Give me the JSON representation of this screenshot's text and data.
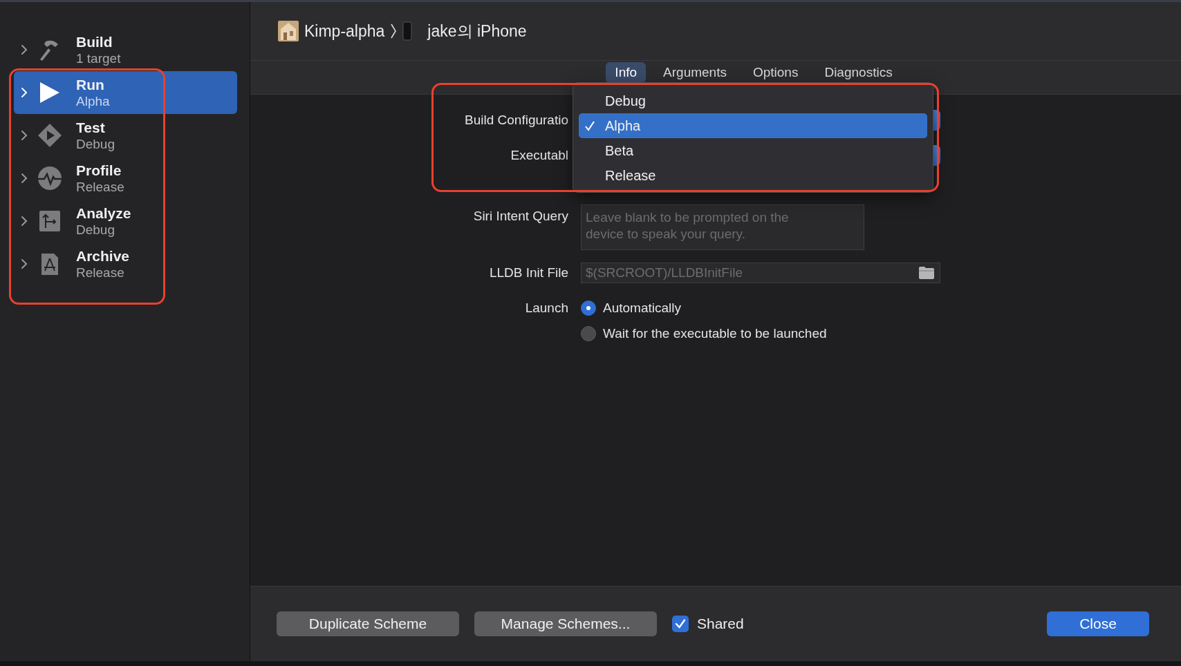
{
  "sidebar": {
    "actions": [
      {
        "kind": "build",
        "name": "Build",
        "detail": "1 target",
        "selected": false
      },
      {
        "kind": "run",
        "name": "Run",
        "detail": "Alpha",
        "selected": true
      },
      {
        "kind": "test",
        "name": "Test",
        "detail": "Debug",
        "selected": false
      },
      {
        "kind": "profile",
        "name": "Profile",
        "detail": "Release",
        "selected": false
      },
      {
        "kind": "analyze",
        "name": "Analyze",
        "detail": "Debug",
        "selected": false
      },
      {
        "kind": "archive",
        "name": "Archive",
        "detail": "Release",
        "selected": false
      }
    ]
  },
  "breadcrumb": {
    "project": "Kimp-alpha",
    "device": "jake의 iPhone"
  },
  "tabs": [
    {
      "label": "Info",
      "selected": true
    },
    {
      "label": "Arguments",
      "selected": false
    },
    {
      "label": "Options",
      "selected": false
    },
    {
      "label": "Diagnostics",
      "selected": false
    }
  ],
  "form": {
    "build_configuration": {
      "label": "Build Configuratio"
    },
    "executable": {
      "label": "Executabl"
    },
    "siri_intent_query": {
      "label": "Siri Intent Query",
      "placeholder": "Leave blank to be prompted on the device to speak your query."
    },
    "lldb_init_file": {
      "label": "LLDB Init File",
      "placeholder": "$(SRCROOT)/LLDBInitFile"
    },
    "launch": {
      "label": "Launch",
      "options": [
        {
          "label": "Automatically",
          "selected": true
        },
        {
          "label": "Wait for the executable to be launched",
          "selected": false
        }
      ]
    }
  },
  "configuration_menu": {
    "items": [
      {
        "label": "Debug",
        "selected": false
      },
      {
        "label": "Alpha",
        "selected": true
      },
      {
        "label": "Beta",
        "selected": false
      },
      {
        "label": "Release",
        "selected": false
      }
    ]
  },
  "footer": {
    "buttons": [
      "Duplicate Scheme",
      "Manage Schemes..."
    ],
    "shared": {
      "label": "Shared",
      "checked": true
    },
    "close": "Close"
  }
}
